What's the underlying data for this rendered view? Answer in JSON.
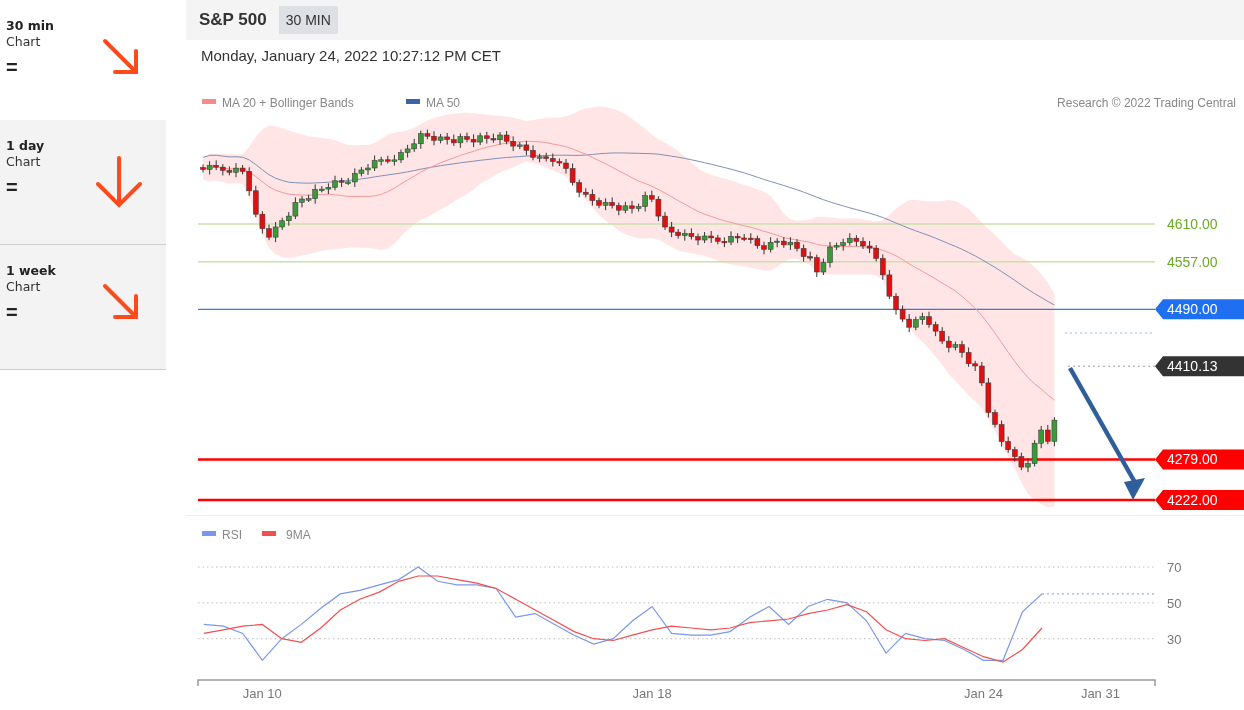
{
  "sidebar": {
    "items": [
      {
        "title": "30 min",
        "subtitle": "Chart",
        "signal": "=",
        "kind": "down-right",
        "selected": true
      },
      {
        "title": "1 day",
        "subtitle": "Chart",
        "signal": "=",
        "kind": "down",
        "selected": false
      },
      {
        "title": "1 week",
        "subtitle": "Chart",
        "signal": "=",
        "kind": "down-right",
        "selected": false
      }
    ]
  },
  "header": {
    "instrument": "S&P 500",
    "interval": "30 MIN"
  },
  "timestamp": "Monday, January 24, 2022 10:27:12 PM CET",
  "price_chart": {
    "legend": [
      {
        "label": "MA 20 + Bollinger Bands",
        "color": "#f88a8a"
      },
      {
        "label": "MA 50",
        "color": "#3c63a6"
      }
    ],
    "credit": "Research © 2022 Trading Central",
    "levels": [
      {
        "label": "4610.00",
        "kind": "resistance"
      },
      {
        "label": "4557.00",
        "kind": "resistance"
      },
      {
        "label": "4490.00",
        "kind": "pivot"
      },
      {
        "label": "4410.13",
        "kind": "last"
      },
      {
        "label": "4279.00",
        "kind": "support"
      },
      {
        "label": "4222.00",
        "kind": "support"
      }
    ]
  },
  "rsi_panel": {
    "chart_data": {
      "type": "line",
      "grid": true,
      "legend": "upper left",
      "yticks": [
        30,
        50,
        70
      ],
      "ylim": [
        7,
        70
      ],
      "categories": [
        null,
        null,
        null,
        "Jan 10",
        null,
        null,
        null,
        null,
        null,
        null,
        null,
        null,
        null,
        null,
        null,
        null,
        null,
        null,
        null,
        null,
        null,
        null,
        null,
        "Jan 18",
        null,
        null,
        null,
        null,
        null,
        null,
        null,
        null,
        null,
        null,
        null,
        null,
        null,
        null,
        null,
        null,
        "Jan 24",
        null,
        null,
        null,
        null,
        null,
        "Jan 31",
        null,
        null
      ],
      "ref_lines": [
        {
          "axis": "y",
          "value": 55,
          "color": "#7b97e8"
        }
      ],
      "series": [
        {
          "name": "RSI",
          "color": "#7b97e8",
          "values": [
            38,
            37,
            33,
            18,
            30,
            38,
            47,
            55,
            57,
            60,
            63,
            70,
            62,
            60,
            60,
            58,
            42,
            44,
            38,
            32,
            27,
            30,
            40,
            48,
            33,
            32,
            32,
            34,
            42,
            48,
            38,
            48,
            52,
            50,
            40,
            22,
            33,
            30,
            29,
            24,
            18,
            18,
            45,
            55,
            null,
            null,
            null,
            null,
            null
          ]
        },
        {
          "name": "9MA",
          "color": "#f05050",
          "values": [
            33,
            35,
            37,
            38,
            30,
            28,
            36,
            46,
            52,
            56,
            62,
            65,
            65,
            63,
            61,
            58,
            52,
            46,
            40,
            34,
            30,
            29,
            32,
            35,
            37,
            36,
            35,
            36,
            39,
            40,
            41,
            44,
            46,
            49,
            45,
            35,
            30,
            29,
            30,
            25,
            20,
            17,
            24,
            36,
            null,
            null,
            null,
            null,
            null
          ]
        }
      ]
    }
  }
}
